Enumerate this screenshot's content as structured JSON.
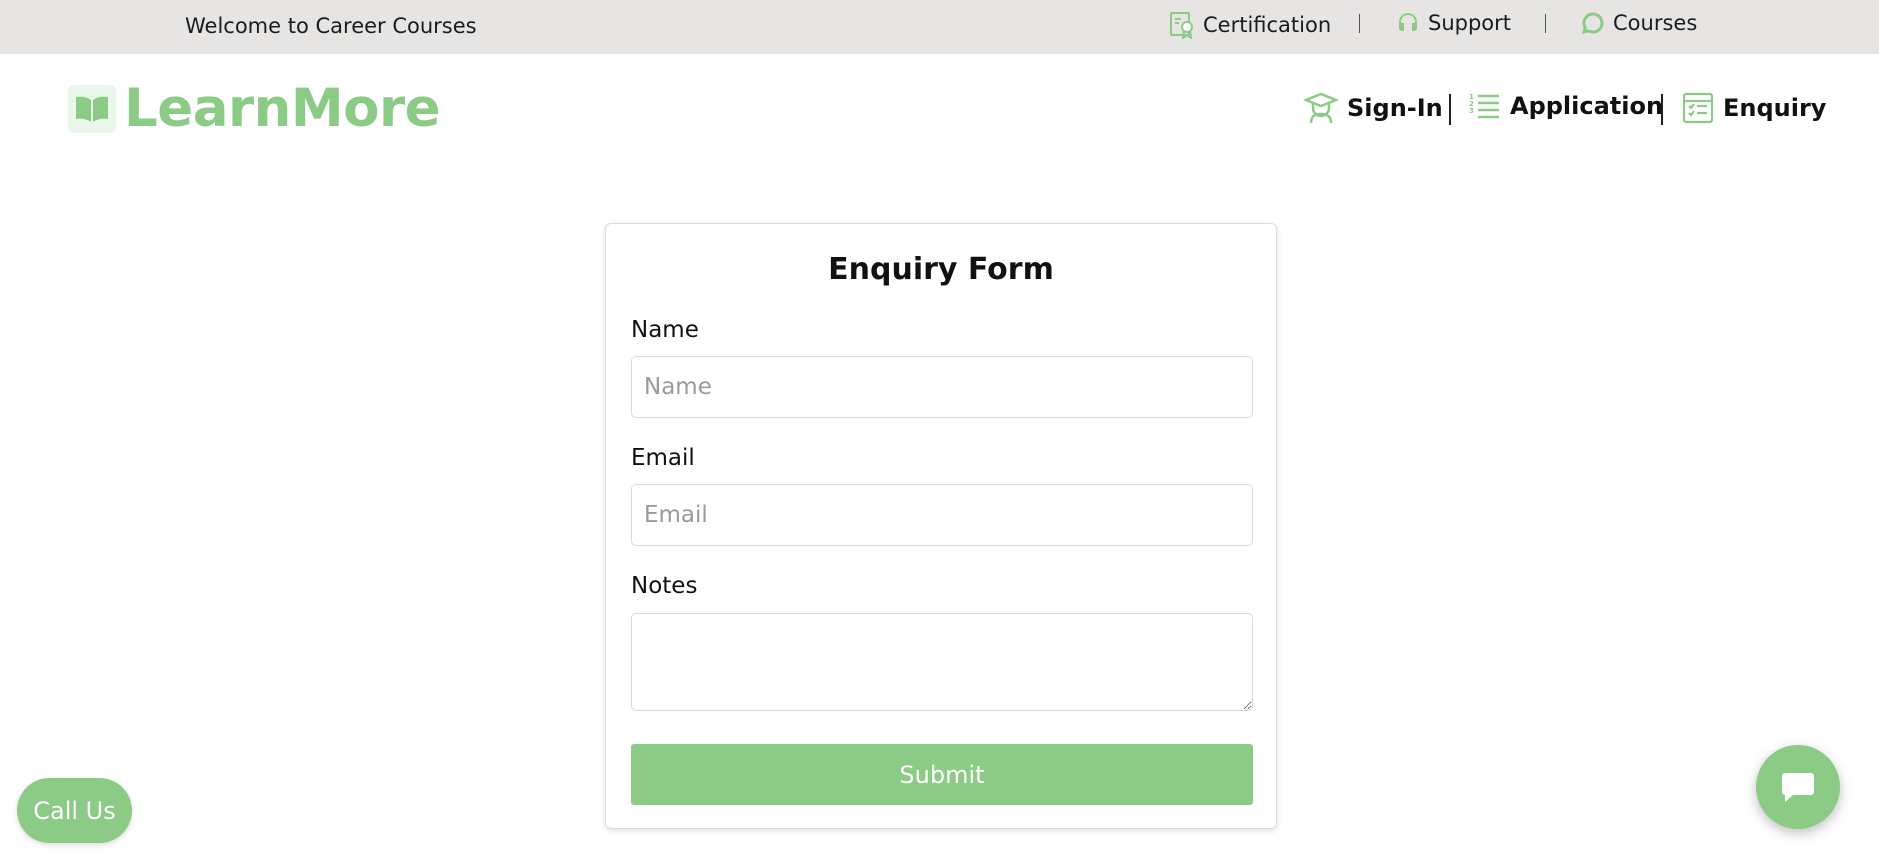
{
  "topbar": {
    "welcome": "Welcome to Career Courses",
    "links": [
      {
        "label": "Certification",
        "icon": "certificate-icon"
      },
      {
        "label": "Support",
        "icon": "headset-icon"
      },
      {
        "label": "Courses",
        "icon": "chat-bubble-icon"
      }
    ]
  },
  "brand": {
    "name": "LearnMore",
    "icon": "book-icon",
    "color": "#8bcb85"
  },
  "nav": [
    {
      "label": "Sign-In",
      "icon": "graduate-icon"
    },
    {
      "label": "Application",
      "icon": "list-icon"
    },
    {
      "label": "Enquiry",
      "icon": "form-icon"
    }
  ],
  "form": {
    "title": "Enquiry Form",
    "name_label": "Name",
    "name_placeholder": "Name",
    "email_label": "Email",
    "email_placeholder": "Email",
    "notes_label": "Notes",
    "submit_label": "Submit"
  },
  "call_us": "Call Us",
  "chat": {
    "icon": "chat-icon"
  },
  "colors": {
    "accent": "#8bcb85",
    "topbar_bg": "#e6e5e3"
  }
}
